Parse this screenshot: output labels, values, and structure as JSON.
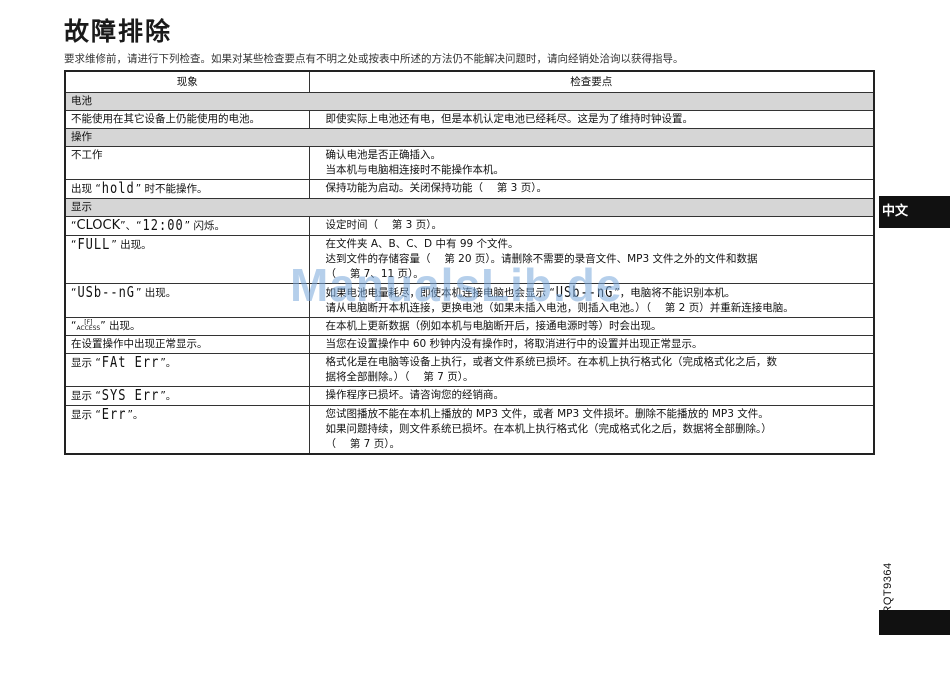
{
  "page": {
    "title": "故障排除",
    "intro": "要求维修前，请进行下列检查。如果对某些检查要点有不明之处或按表中所述的方法仍不能解决问题时，请向经销处洽询以获得指导。",
    "watermark": "ManualsLib.de",
    "language_tab": "中文",
    "doc_code": "RQT9364"
  },
  "table": {
    "headers": [
      "现象",
      "检查要点"
    ],
    "battery": {
      "section": "电池",
      "r1": {
        "symptom": "不能使用在其它设备上仍能使用的电池。",
        "check": "即使实际上电池还有电，但是本机认定电池已经耗尽。这是为了维持时钟设置。"
      }
    },
    "operation": {
      "section": "操作",
      "r1": {
        "symptom": "不工作",
        "check1": "确认电池是否正确插入。",
        "check2": "当本机与电脑相连接时不能操作本机。"
      },
      "r2": {
        "prefix": "出现 “",
        "seg": "hold",
        "suffix": "” 时不能操作。",
        "check": "保持功能为启动。关闭保持功能（　 第 3 页）。"
      }
    },
    "display": {
      "section": "显示",
      "r1": {
        "q1": "“",
        "word": "CLOCK",
        "q2": "”、“",
        "seg": "12:00",
        "q3": "” 闪烁。",
        "check": "设定时间（　 第 3 页）。"
      },
      "r2": {
        "q1": "“",
        "seg": "FULL",
        "q2": "” 出现。",
        "check1": "在文件夹 A、B、C、D 中有 99 个文件。",
        "check2": "达到文件的存储容量（　 第 20 页）。请删除不需要的录音文件、MP3 文件之外的文件和数据",
        "check3": "（　 第 7、11 页）。"
      },
      "r3": {
        "q1": "“",
        "seg": "USb--nG",
        "q2": "” 出现。",
        "check1a": "如果电池电量耗尽，即使本机连接电脑也会显示 “",
        "check1seg": "USb--nG",
        "check1b": "”，电脑将不能识别本机。",
        "check2": "请从电脑断开本机连接，更换电池（如果未插入电池，则插入电池。）（　 第 2 页）并重新连接电脑。"
      },
      "r4": {
        "q1": "“",
        "seg": "[F]",
        "access": "ACCESS",
        "q2": "” 出现。",
        "check": "在本机上更新数据（例如本机与电脑断开后，接通电源时等）时会出现。"
      },
      "r5": {
        "symptom": "在设置操作中出现正常显示。",
        "check": "当您在设置操作中 60 秒钟内没有操作时，将取消进行中的设置并出现正常显示。"
      },
      "r6": {
        "prefix": "显示 “",
        "seg": "FAt Err",
        "suffix": "”。",
        "check1": "格式化是在电脑等设备上执行，或者文件系统已损坏。在本机上执行格式化（完成格式化之后，数",
        "check2": "据将全部删除。）（　 第 7 页）。"
      },
      "r7": {
        "prefix": "显示 “",
        "seg": "SYS Err",
        "suffix": "”。",
        "check": "操作程序已损坏。请咨询您的经销商。"
      },
      "r8": {
        "prefix": "显示 “",
        "seg": "Err",
        "suffix": "”。",
        "check1": "您试图播放不能在本机上播放的 MP3 文件，或者 MP3 文件损坏。删除不能播放的 MP3 文件。",
        "check2": "如果问题持续，则文件系统已损坏。在本机上执行格式化（完成格式化之后，数据将全部删除。）",
        "check3": "（　 第 7 页）。"
      }
    }
  },
  "colors": {
    "section_bg": "#d6d6d6",
    "tab_bg": "#111111",
    "watermark": "#7aa9dc"
  }
}
